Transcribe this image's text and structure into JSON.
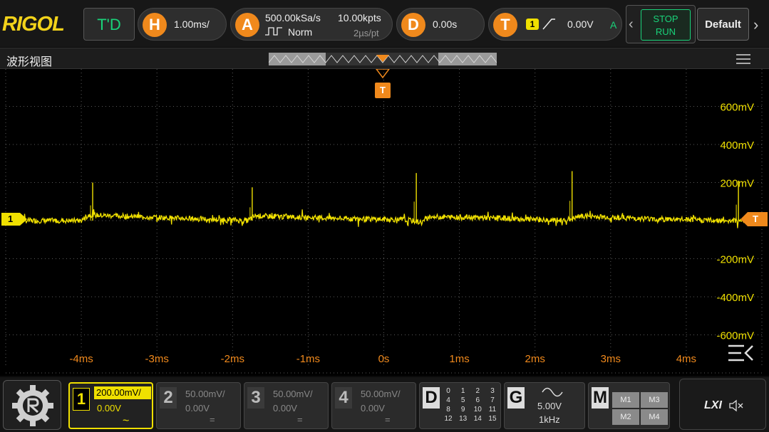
{
  "brand": "RIGOL",
  "topbar": {
    "mode": "T'D",
    "horizontal": {
      "letter": "H",
      "value": "1.00ms/"
    },
    "acquire": {
      "letter": "A",
      "sample_rate": "500.00kSa/s",
      "points": "10.00kpts",
      "mode": "Norm",
      "per_point": "2µs/pt"
    },
    "delay": {
      "letter": "D",
      "value": "0.00s"
    },
    "trigger": {
      "letter": "T",
      "channel": "1",
      "level": "0.00V",
      "mode_flag": "A"
    },
    "stop_label": "STOP",
    "run_label": "RUN",
    "default_label": "Default"
  },
  "view": {
    "title": "波形视图"
  },
  "axes": {
    "y_labels": [
      "600mV",
      "400mV",
      "200mV",
      "-200mV",
      "-400mV",
      "-600mV"
    ],
    "x_labels": [
      "-4ms",
      "-3ms",
      "-2ms",
      "-1ms",
      "0s",
      "1ms",
      "2ms",
      "3ms",
      "4ms"
    ],
    "ch_marker": "1",
    "trig_marker": "T"
  },
  "chart_data": {
    "type": "line",
    "title": "",
    "xlabel": "",
    "ylabel": "",
    "xlim": [
      -5,
      5
    ],
    "ylim": [
      -800,
      800
    ],
    "x_unit": "ms",
    "y_unit": "mV",
    "series": [
      {
        "color": "#f0e000",
        "x": [
          -5,
          -4.0,
          -3.9,
          -2.5,
          -1.8,
          -1.7,
          -0.5,
          0.3,
          0.5,
          0.6,
          1.5,
          2.3,
          2.5,
          2.6,
          3.5,
          4.5,
          4.9,
          5
        ],
        "y": [
          0,
          0,
          30,
          10,
          0,
          25,
          10,
          5,
          -10,
          20,
          15,
          0,
          10,
          25,
          10,
          0,
          5,
          0
        ]
      }
    ],
    "spikes": [
      {
        "x": -3.85,
        "y": 200
      },
      {
        "x": -1.74,
        "y": 175
      },
      {
        "x": 0.43,
        "y": 250
      },
      {
        "x": 2.49,
        "y": 260
      },
      {
        "x": 4.69,
        "y": 210
      }
    ]
  },
  "channels": [
    {
      "num": "1",
      "scale": "200.00mV/",
      "offset": "0.00V",
      "coupling": "~",
      "active": true
    },
    {
      "num": "2",
      "scale": "50.00mV/",
      "offset": "0.00V",
      "coupling": "=",
      "active": false
    },
    {
      "num": "3",
      "scale": "50.00mV/",
      "offset": "0.00V",
      "coupling": "=",
      "active": false
    },
    {
      "num": "4",
      "scale": "50.00mV/",
      "offset": "0.00V",
      "coupling": "=",
      "active": false
    }
  ],
  "digital": {
    "letter": "D",
    "rows": [
      [
        "0",
        "1",
        "2",
        "3"
      ],
      [
        "4",
        "5",
        "6",
        "7"
      ],
      [
        "8",
        "9",
        "10",
        "11"
      ],
      [
        "12",
        "13",
        "14",
        "15"
      ]
    ]
  },
  "generator": {
    "letter": "G",
    "amplitude": "5.00V",
    "freq": "1kHz"
  },
  "math": {
    "letter": "M",
    "items": [
      "M1",
      "M3",
      "M2",
      "M4"
    ]
  },
  "lxi": "LXI",
  "colors": {
    "accent": "#f0891c",
    "ch1": "#f0e000",
    "run_green": "#19d37a"
  }
}
